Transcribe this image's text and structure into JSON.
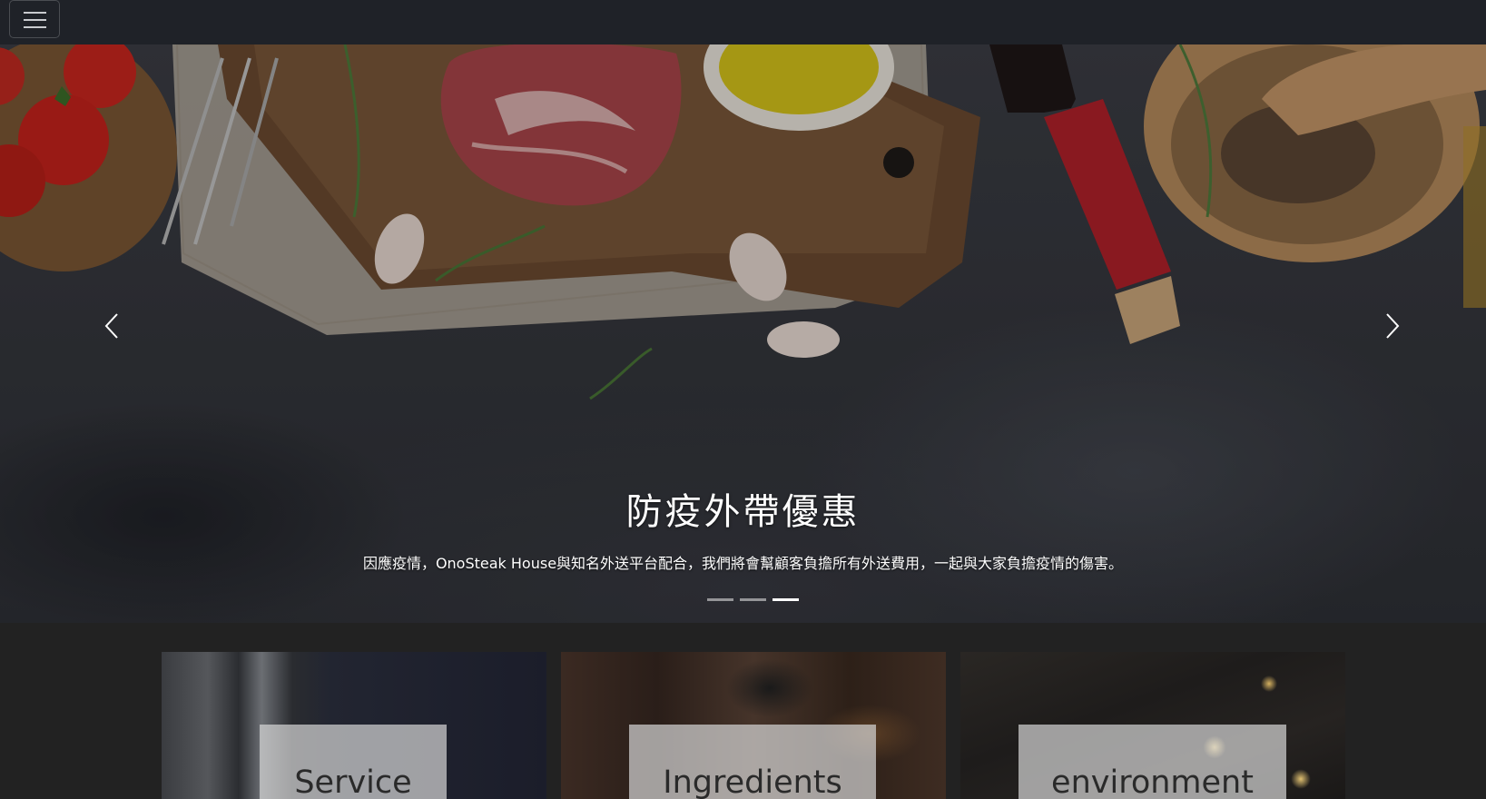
{
  "navbar": {
    "toggler_icon": "hamburger-menu-icon"
  },
  "carousel": {
    "title": "防疫外帶優惠",
    "text": "因應疫情，OnoSteak House與知名外送平台配合，我們將會幫顧客負擔所有外送費用，一起與大家負擔疫情的傷害。",
    "slide_count": 3,
    "active_index": 2,
    "prev_icon": "chevron-left-icon",
    "next_icon": "chevron-right-icon"
  },
  "cards": [
    {
      "label": "Service"
    },
    {
      "label": "Ingredients"
    },
    {
      "label": "environment"
    }
  ],
  "colors": {
    "navbar_bg": "#1f2228",
    "page_bg": "#222222",
    "caption_text": "#ffffff"
  }
}
